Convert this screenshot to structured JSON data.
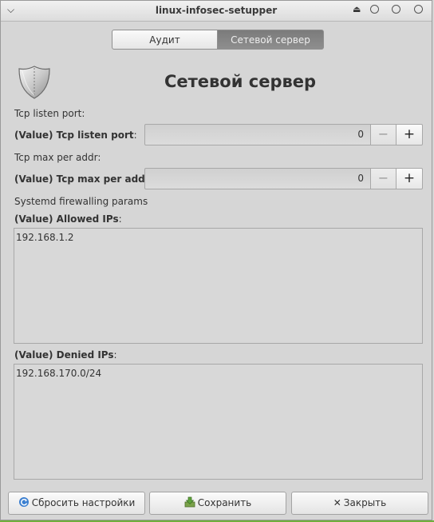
{
  "window": {
    "title": "linux-infosec-setupper"
  },
  "tabs": [
    {
      "label": "Аудит",
      "active": false
    },
    {
      "label": "Сетевой сервер",
      "active": true
    }
  ],
  "page": {
    "title": "Сетевой сервер",
    "icon": "shield-icon"
  },
  "tcp_listen": {
    "section_label": "Tcp listen port:",
    "value_label_bold": "(Value) Tcp listen port",
    "value": "0"
  },
  "tcp_max": {
    "section_label": "Tcp max per addr:",
    "value_label_bold": "(Value) Tcp max per addr",
    "value": "0"
  },
  "firewall": {
    "section_label": "Systemd firewalling params",
    "allowed_label_bold": "(Value) Allowed IPs",
    "allowed_value": "192.168.1.2",
    "denied_label_bold": "(Value) Denied IPs",
    "denied_value": "192.168.170.0/24"
  },
  "spin": {
    "minus": "−",
    "plus": "+"
  },
  "buttons": {
    "reset": "Сбросить настройки",
    "save": "Сохранить",
    "close": "Закрыть"
  },
  "colors": {
    "accent_line": "#6fae3c",
    "active_tab": "#858585"
  }
}
